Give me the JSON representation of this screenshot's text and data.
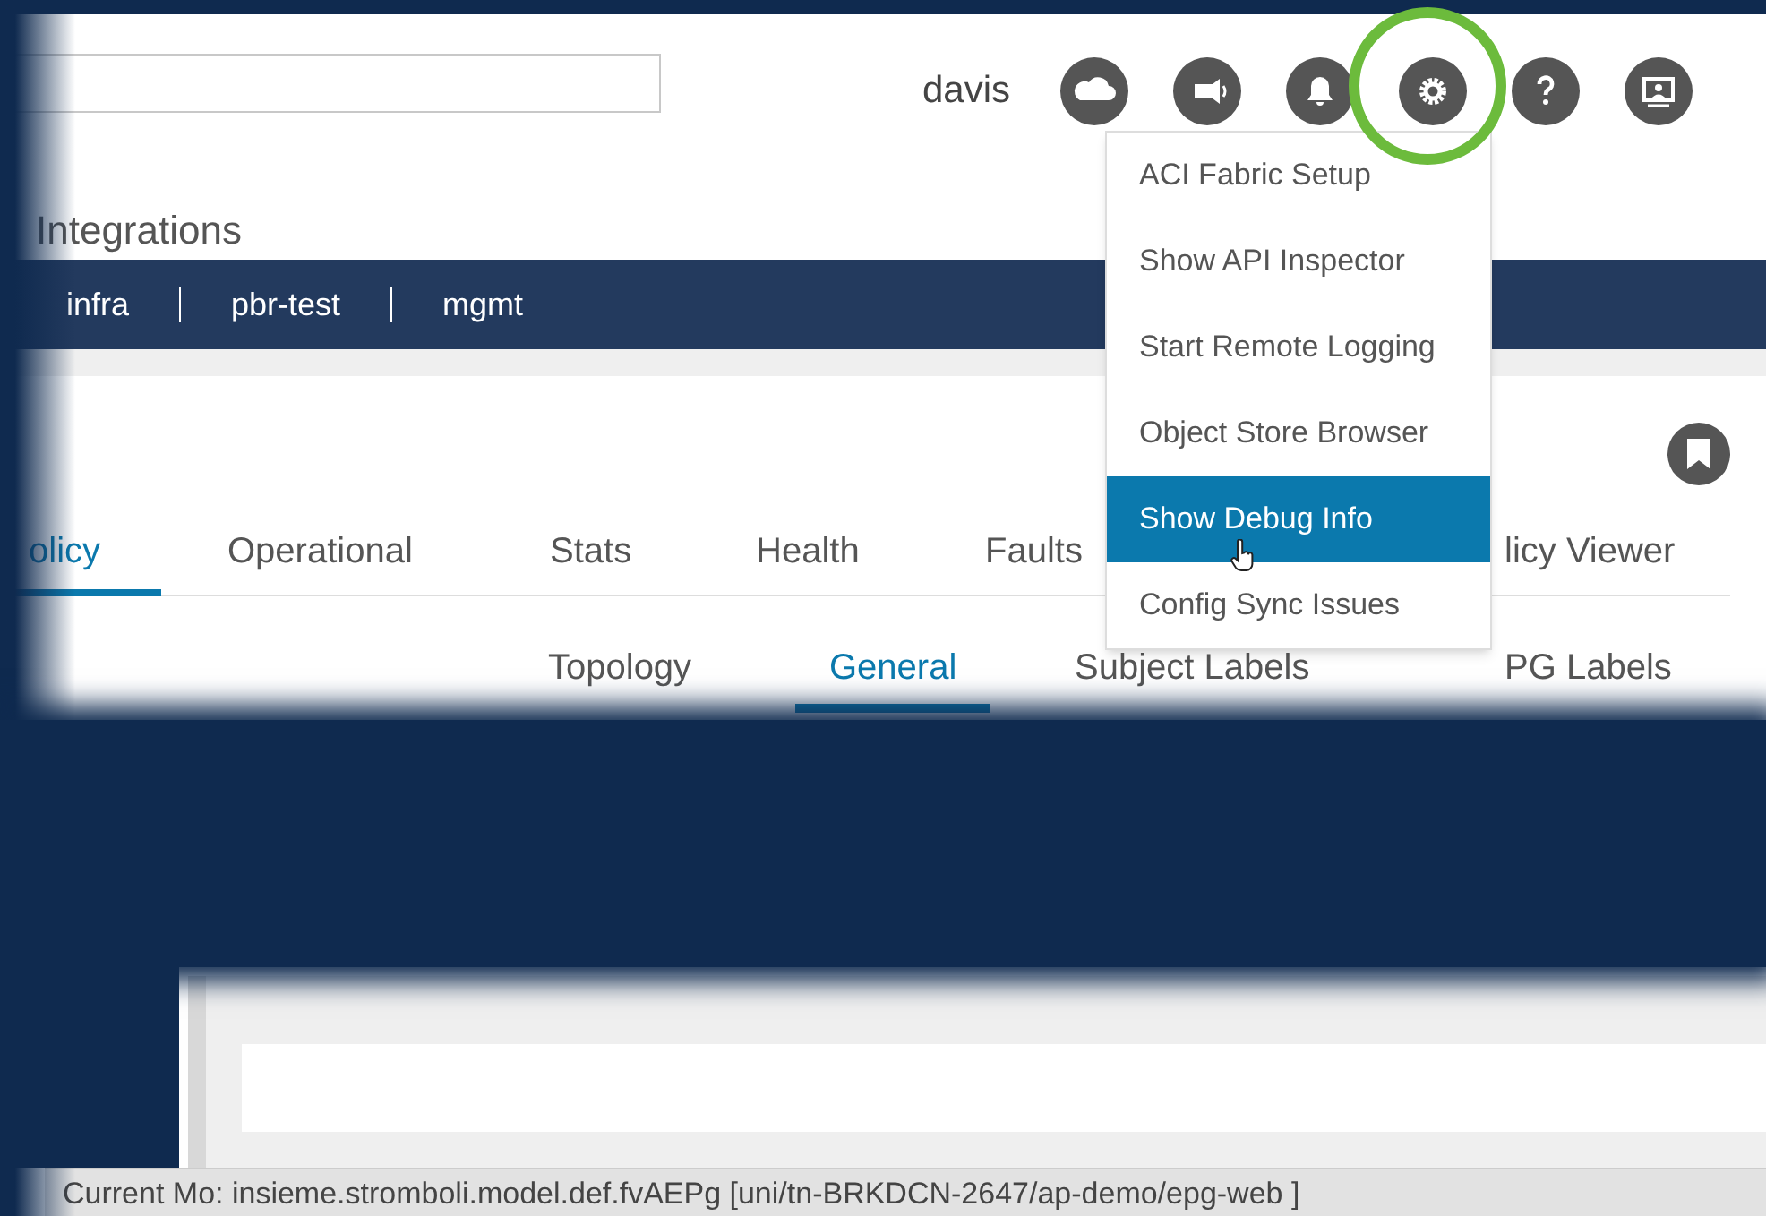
{
  "header": {
    "user": "davis"
  },
  "page_title": "Integrations",
  "tenant_tabs": [
    {
      "label": "infra"
    },
    {
      "label": "pbr-test"
    },
    {
      "label": "mgmt"
    }
  ],
  "tabs": [
    {
      "label": "olicy",
      "selected": true
    },
    {
      "label": "Operational",
      "selected": false
    },
    {
      "label": "Stats",
      "selected": false
    },
    {
      "label": "Health",
      "selected": false
    },
    {
      "label": "Faults",
      "selected": false
    },
    {
      "label": "licy Viewer",
      "selected": false
    }
  ],
  "sub_tabs": [
    {
      "label": "Topology",
      "selected": false
    },
    {
      "label": "General",
      "selected": true
    },
    {
      "label": "Subject Labels",
      "selected": false
    },
    {
      "label": "PG Labels",
      "selected": false
    }
  ],
  "settings_menu": {
    "items": [
      {
        "label": "ACI Fabric Setup",
        "selected": false
      },
      {
        "label": "Show API Inspector",
        "selected": false
      },
      {
        "label": "Start Remote Logging",
        "selected": false
      },
      {
        "label": "Object Store Browser",
        "selected": false
      },
      {
        "label": "Show Debug Info",
        "selected": true
      },
      {
        "label": "Config Sync Issues",
        "selected": false
      }
    ]
  },
  "status_bar": "Current Mo: insieme.stromboli.model.def.fvAEPg [uni/tn-BRKDCN-2647/ap-demo/epg-web ]"
}
